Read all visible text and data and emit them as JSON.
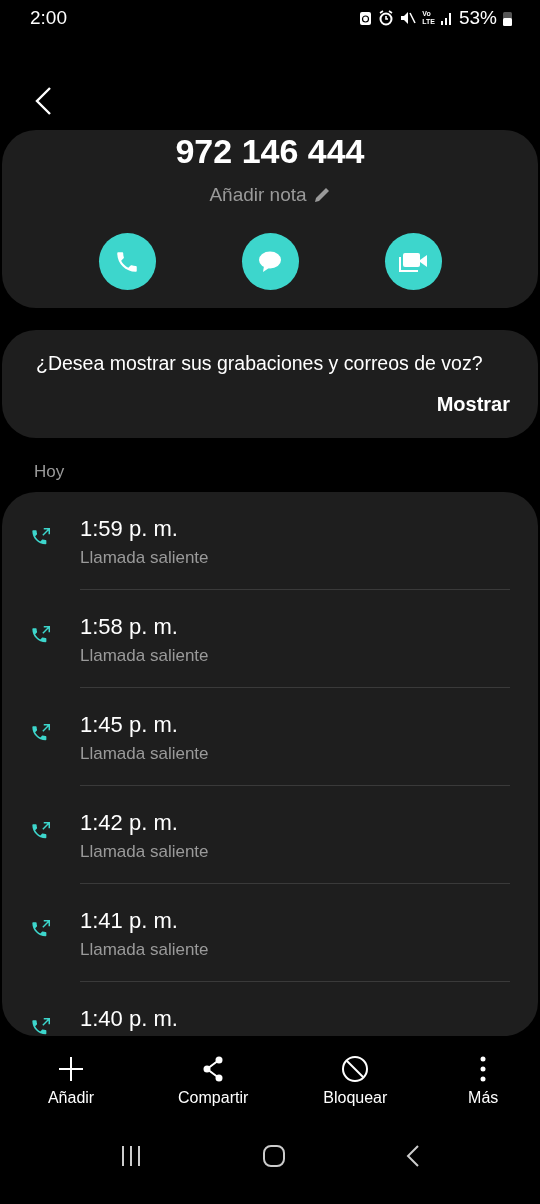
{
  "status_bar": {
    "time": "2:00",
    "network_top": "Vo",
    "network_bottom": "LTE",
    "battery": "53%"
  },
  "contact": {
    "number": "972 146 444",
    "note": "Añadir nota"
  },
  "prompt": {
    "text": "¿Desea mostrar sus grabaciones y correos de voz?",
    "action": "Mostrar"
  },
  "section": "Hoy",
  "calls": [
    {
      "time": "1:59 p. m.",
      "type": "Llamada saliente"
    },
    {
      "time": "1:58 p. m.",
      "type": "Llamada saliente"
    },
    {
      "time": "1:45 p. m.",
      "type": "Llamada saliente"
    },
    {
      "time": "1:42 p. m.",
      "type": "Llamada saliente"
    },
    {
      "time": "1:41 p. m.",
      "type": "Llamada saliente"
    },
    {
      "time": "1:40 p. m."
    }
  ],
  "actions": [
    {
      "kind": "add",
      "label": "Añadir"
    },
    {
      "kind": "share",
      "label": "Compartir"
    },
    {
      "kind": "block",
      "label": "Bloquear"
    },
    {
      "kind": "more",
      "label": "Más"
    }
  ]
}
